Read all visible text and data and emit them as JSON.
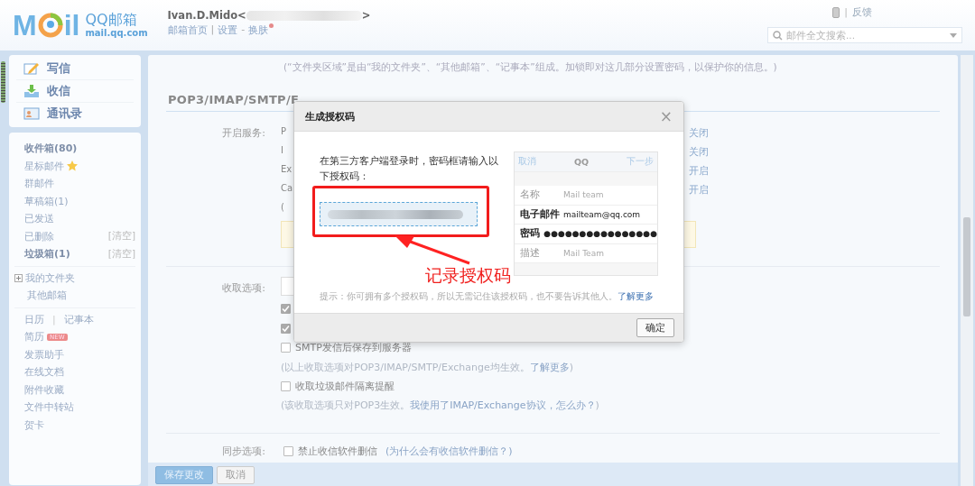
{
  "header": {
    "logo_left": "M",
    "logo_right": "il",
    "product": "QQ邮箱",
    "domain": "mail.qq.com",
    "user_name": "Ivan.D.Mido<",
    "user_name_end": ">",
    "nav": [
      {
        "kind": "link",
        "text": "邮箱首页",
        "dot": false
      },
      {
        "kind": "sep",
        "text": "|",
        "dot": false
      },
      {
        "kind": "link",
        "text": "设置",
        "dot": false
      },
      {
        "kind": "sep",
        "text": "-",
        "dot": false
      },
      {
        "kind": "link",
        "text": "换肤",
        "dot": true
      }
    ],
    "top_right": {
      "separator": "|",
      "feedback": "反馈"
    },
    "search": {
      "placeholder": "邮件全文搜索..."
    }
  },
  "sidebar": {
    "actions": [
      {
        "kind": "compose",
        "label": "写信"
      },
      {
        "kind": "receive",
        "label": "收信"
      },
      {
        "kind": "contacts",
        "label": "通讯录"
      }
    ],
    "folders": [
      {
        "label": "收件箱(80)",
        "bold": true,
        "star": false
      },
      {
        "label": "星标邮件",
        "bold": false,
        "star": true
      },
      {
        "label": "群邮件",
        "bold": false,
        "star": false
      },
      {
        "label": "草稿箱(1)",
        "bold": false,
        "star": false
      },
      {
        "label": "已发送",
        "bold": false,
        "star": false
      },
      {
        "label": "已删除",
        "bold": false,
        "star": false,
        "action": "[清空]"
      },
      {
        "label": "垃圾箱(1)",
        "bold": true,
        "star": false,
        "action": "[清空]"
      }
    ],
    "groups": [
      {
        "label": "我的文件夹",
        "expandable": true
      },
      {
        "label": "其他邮箱",
        "expandable": false
      }
    ],
    "tools": [
      {
        "kind": "pair",
        "items": [
          "日历",
          "记事本"
        ],
        "separator": "|"
      },
      {
        "kind": "link",
        "label": "简历",
        "badge": "NEW"
      },
      {
        "kind": "link",
        "label": "发票助手"
      },
      {
        "kind": "link",
        "label": "在线文档"
      },
      {
        "kind": "link",
        "label": "附件收藏"
      },
      {
        "kind": "link",
        "label": "文件中转站"
      },
      {
        "kind": "link",
        "label": "贺卡"
      }
    ]
  },
  "content": {
    "note": "(“文件夹区域”是由“我的文件夹”、“其他邮箱”、“记事本”组成。加锁即对这几部分设置密码，以保护你的信息。)",
    "section_title": "POP3/IMAP/SMTP/E",
    "services": {
      "label": "开启服务:",
      "rows": [
        {
          "name": "P",
          "status": "关闭"
        },
        {
          "name": "I",
          "status": "关闭"
        },
        {
          "name": "Ex",
          "status": "开启"
        },
        {
          "name": "Ca",
          "status": "开启"
        }
      ],
      "note": "("
    },
    "receive": {
      "label": "收取选项:",
      "options": [
        {
          "checked": true
        },
        {
          "checked": true
        },
        {
          "checked": false,
          "text": "SMTP发信后保存到服务器"
        }
      ],
      "note": {
        "before": "(以上收取选项对POP3/IMAP/SMTP/Exchange均生效。",
        "link": "了解更多",
        "after": ")"
      },
      "spam": {
        "checked": false,
        "text": "收取垃圾邮件隔离提醒"
      },
      "spam_note": {
        "before": "(该收取选项只对POP3生效。",
        "link": "我使用了IMAP/Exchange协议，怎么办？",
        "after": ")"
      }
    },
    "sync": {
      "label": "同步选项:",
      "checked": false,
      "text": "禁止收信软件删信",
      "link": "(为什么会有收信软件删信？)"
    },
    "buttons": [
      {
        "label": "保存更改",
        "primary": true
      },
      {
        "label": "取消",
        "primary": false
      }
    ]
  },
  "dialog": {
    "title": "生成授权码",
    "close": "×",
    "instruction": "在第三方客户端登录时，密码框请输入以下授权码：",
    "preview": {
      "cancel": "取消",
      "title": "QQ",
      "next": "下一步",
      "fields": [
        {
          "label": "名称",
          "value": "Mail team",
          "emphasis": false
        },
        {
          "label": "电子邮件",
          "value": "mailteam@qq.com",
          "emphasis": true
        },
        {
          "label": "密码",
          "value": "●●●●●●●●●●●●●●●●",
          "emphasis": true
        },
        {
          "label": "描述",
          "value": "Mail Team",
          "emphasis": false
        }
      ]
    },
    "tip": "提示：你可拥有多个授权码，所以无需记住该授权码，也不要告诉其他人。",
    "tip_link": "了解更多",
    "ok": "确定"
  },
  "annotation": {
    "text": "记录授权码"
  }
}
